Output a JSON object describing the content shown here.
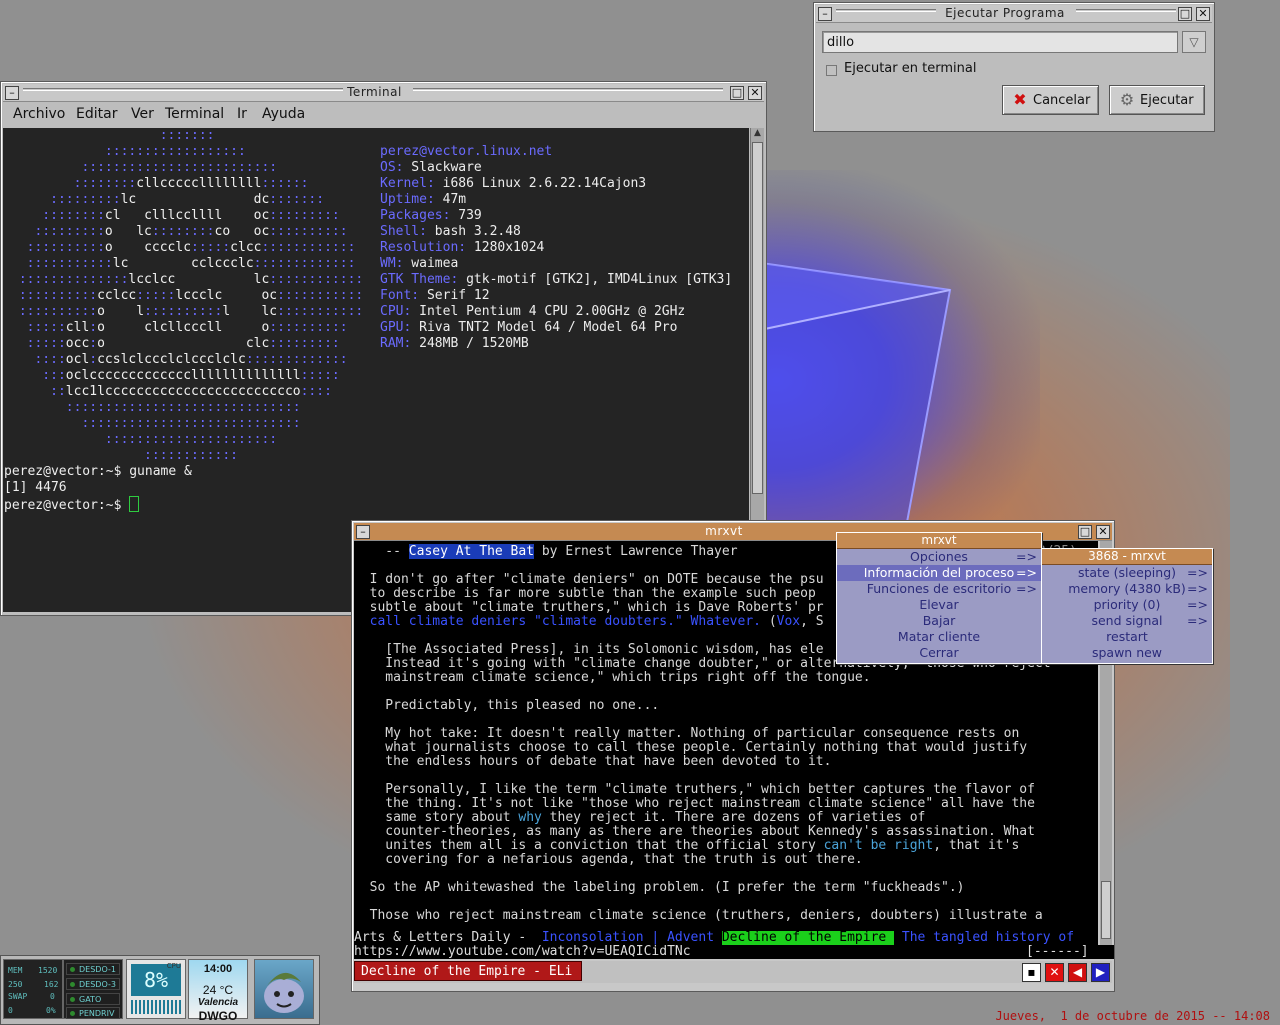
{
  "terminal": {
    "title": "Terminal",
    "menu": [
      "Archivo",
      "Editar",
      "Ver",
      "Terminal",
      "Ir",
      "Ayuda"
    ],
    "sysinfo": [
      {
        "k": "perez@vector.linux.net",
        "v": ""
      },
      {
        "k": "OS:",
        "v": " Slackware"
      },
      {
        "k": "Kernel:",
        "v": " i686 Linux 2.6.22.14Cajon3"
      },
      {
        "k": "Uptime:",
        "v": " 47m"
      },
      {
        "k": "Packages:",
        "v": " 739"
      },
      {
        "k": "Shell:",
        "v": " bash 3.2.48"
      },
      {
        "k": "Resolution:",
        "v": " 1280x1024"
      },
      {
        "k": "WM:",
        "v": " waimea"
      },
      {
        "k": "GTK Theme:",
        "v": " gtk-motif [GTK2], IMD4Linux [GTK3]"
      },
      {
        "k": "Font:",
        "v": " Serif 12"
      },
      {
        "k": "CPU:",
        "v": " Intel Pentium 4 CPU 2.00GHz @ 2GHz"
      },
      {
        "k": "GPU:",
        "v": " Riva TNT2 Model 64 / Model 64 Pro"
      },
      {
        "k": "RAM:",
        "v": " 248MB / 1520MB"
      }
    ],
    "prompt_lines": [
      "perez@vector:~$ guname &",
      "[1] 4476",
      "perez@vector:~$ "
    ]
  },
  "run_dialog": {
    "title": "Ejecutar Programa",
    "command_value": "dillo",
    "checkbox_label": "Ejecutar en terminal",
    "cancel_label": "Cancelar",
    "run_label": "Ejecutar"
  },
  "mrxvt": {
    "title": "mrxvt",
    "lines": [
      {
        "segs": [
          {
            "t": "    -- ",
            "c": ""
          },
          {
            "t": "Casey At The Bat",
            "c": "hl"
          },
          {
            "t": " by Ernest Lawrence Thayer",
            "c": ""
          }
        ]
      },
      {
        "segs": [
          {
            "t": "",
            "c": ""
          }
        ]
      },
      {
        "segs": [
          {
            "t": "  I don't go after \"climate deniers\" on DOTE because the psu",
            "c": ""
          }
        ]
      },
      {
        "segs": [
          {
            "t": "  to describe is far more subtle than the example such peop",
            "c": ""
          }
        ]
      },
      {
        "segs": [
          {
            "t": "  subtle about \"climate truthers,\" which is Dave Roberts' pr",
            "c": ""
          }
        ]
      },
      {
        "segs": [
          {
            "t": "  call climate deniers \"climate doubters.\" Whatever.",
            "c": "lk"
          },
          {
            "t": " (",
            "c": ""
          },
          {
            "t": "Vox",
            "c": "lk"
          },
          {
            "t": ", S",
            "c": ""
          }
        ]
      },
      {
        "segs": [
          {
            "t": "",
            "c": ""
          }
        ]
      },
      {
        "segs": [
          {
            "t": "    [The Associated Press], in its Solomonic wisdom, has ele",
            "c": ""
          }
        ]
      },
      {
        "segs": [
          {
            "t": "    Instead it's going with \"climate change doubter,\" or alternatively, \"those who reject",
            "c": ""
          }
        ]
      },
      {
        "segs": [
          {
            "t": "    mainstream climate science,\" which trips right off the tongue.",
            "c": ""
          }
        ]
      },
      {
        "segs": [
          {
            "t": "",
            "c": ""
          }
        ]
      },
      {
        "segs": [
          {
            "t": "    Predictably, this pleased no one...",
            "c": ""
          }
        ]
      },
      {
        "segs": [
          {
            "t": "",
            "c": ""
          }
        ]
      },
      {
        "segs": [
          {
            "t": "    My hot take: It doesn't really matter. Nothing of particular consequence rests on",
            "c": ""
          }
        ]
      },
      {
        "segs": [
          {
            "t": "    what journalists choose to call these people. Certainly nothing that would justify",
            "c": ""
          }
        ]
      },
      {
        "segs": [
          {
            "t": "    the endless hours of debate that have been devoted to it.",
            "c": ""
          }
        ]
      },
      {
        "segs": [
          {
            "t": "",
            "c": ""
          }
        ]
      },
      {
        "segs": [
          {
            "t": "    Personally, I like the term \"climate truthers,\" which better captures the flavor of",
            "c": ""
          }
        ]
      },
      {
        "segs": [
          {
            "t": "    the thing. It's not like \"those who reject mainstream climate science\" all have the",
            "c": ""
          }
        ]
      },
      {
        "segs": [
          {
            "t": "    same story about ",
            "c": ""
          },
          {
            "t": "why",
            "c": "lk2"
          },
          {
            "t": " they reject it. There are dozens of varieties of",
            "c": ""
          }
        ]
      },
      {
        "segs": [
          {
            "t": "    counter-theories, as many as there are theories about Kennedy's assassination. What",
            "c": ""
          }
        ]
      },
      {
        "segs": [
          {
            "t": "    unites them all is a conviction that the official story ",
            "c": ""
          },
          {
            "t": "can't be right",
            "c": "lk2"
          },
          {
            "t": ", that it's",
            "c": ""
          }
        ]
      },
      {
        "segs": [
          {
            "t": "    covering for a nefarious agenda, that the truth is out there.",
            "c": ""
          }
        ]
      },
      {
        "segs": [
          {
            "t": "",
            "c": ""
          }
        ]
      },
      {
        "segs": [
          {
            "t": "  So the AP whitewashed the labeling problem. (I prefer the term \"fuckheads\".)",
            "c": ""
          }
        ]
      },
      {
        "segs": [
          {
            "t": "",
            "c": ""
          }
        ]
      },
      {
        "segs": [
          {
            "t": "  Those who reject mainstream climate science (truthers, deniers, doubters) illustrate a",
            "c": ""
          }
        ]
      }
    ],
    "status_segs": [
      {
        "t": "Arts & Letters Daily - ",
        "c": ""
      },
      {
        "t": " Inconsolation | Advent ",
        "c": "lk"
      },
      {
        "t": "Decline of the Empire ",
        "c": "stat-grn"
      },
      {
        "t": " The tangled history of",
        "c": "lk"
      }
    ],
    "url": "https://www.youtube.com/watch?v=UEAQICidTNc",
    "url_right": "[------]",
    "tab_label": "Decline of the Empire - ELi",
    "page_counter": "(2/25)"
  },
  "menu_main": {
    "title": "mrxvt",
    "items": [
      {
        "label": "Opciones",
        "arrow": "=>"
      },
      {
        "label": "Información del proceso",
        "arrow": "=>",
        "sel": true
      },
      {
        "label": "Funciones de escritorio",
        "arrow": "=>"
      },
      {
        "label": "Elevar",
        "arrow": ""
      },
      {
        "label": "Bajar",
        "arrow": ""
      },
      {
        "label": "Matar cliente",
        "arrow": ""
      },
      {
        "label": "Cerrar",
        "arrow": ""
      }
    ]
  },
  "menu_sub": {
    "title": "3868 - mrxvt",
    "items": [
      {
        "label": "state (sleeping)",
        "arrow": "=>"
      },
      {
        "label": "memory (4380 kB)",
        "arrow": "=>"
      },
      {
        "label": "priority (0)",
        "arrow": "=>"
      },
      {
        "label": "send signal",
        "arrow": "=>"
      },
      {
        "label": "restart",
        "arrow": ""
      },
      {
        "label": "spawn new",
        "arrow": ""
      }
    ]
  },
  "dock": {
    "mem": {
      "mem_label": "MEM",
      "mem_val": "1520",
      "row2_a": "250",
      "row2_b": "162",
      "swap_label": "SWAP",
      "swap_val": "0",
      "row4_a": "0",
      "row4_b": "0%"
    },
    "desktops": [
      "DESDO-1",
      "DESDO-3",
      "GATO",
      "PENDRIV"
    ],
    "cpu": {
      "label": "CPU",
      "value": "8%"
    },
    "weather": {
      "time": "14:00",
      "temp": "24 °C",
      "city": "Valencia",
      "code": "DWGO"
    }
  },
  "clock": "Jueves,  1 de octubre de 2015 -- 14:08",
  "colors": {
    "accent_orange": "#c58a52",
    "menu_bg": "#9b9bc4",
    "ascii_blue": "#6b6bff",
    "link_blue": "#3a52ff",
    "clock_red": "#b01010"
  }
}
